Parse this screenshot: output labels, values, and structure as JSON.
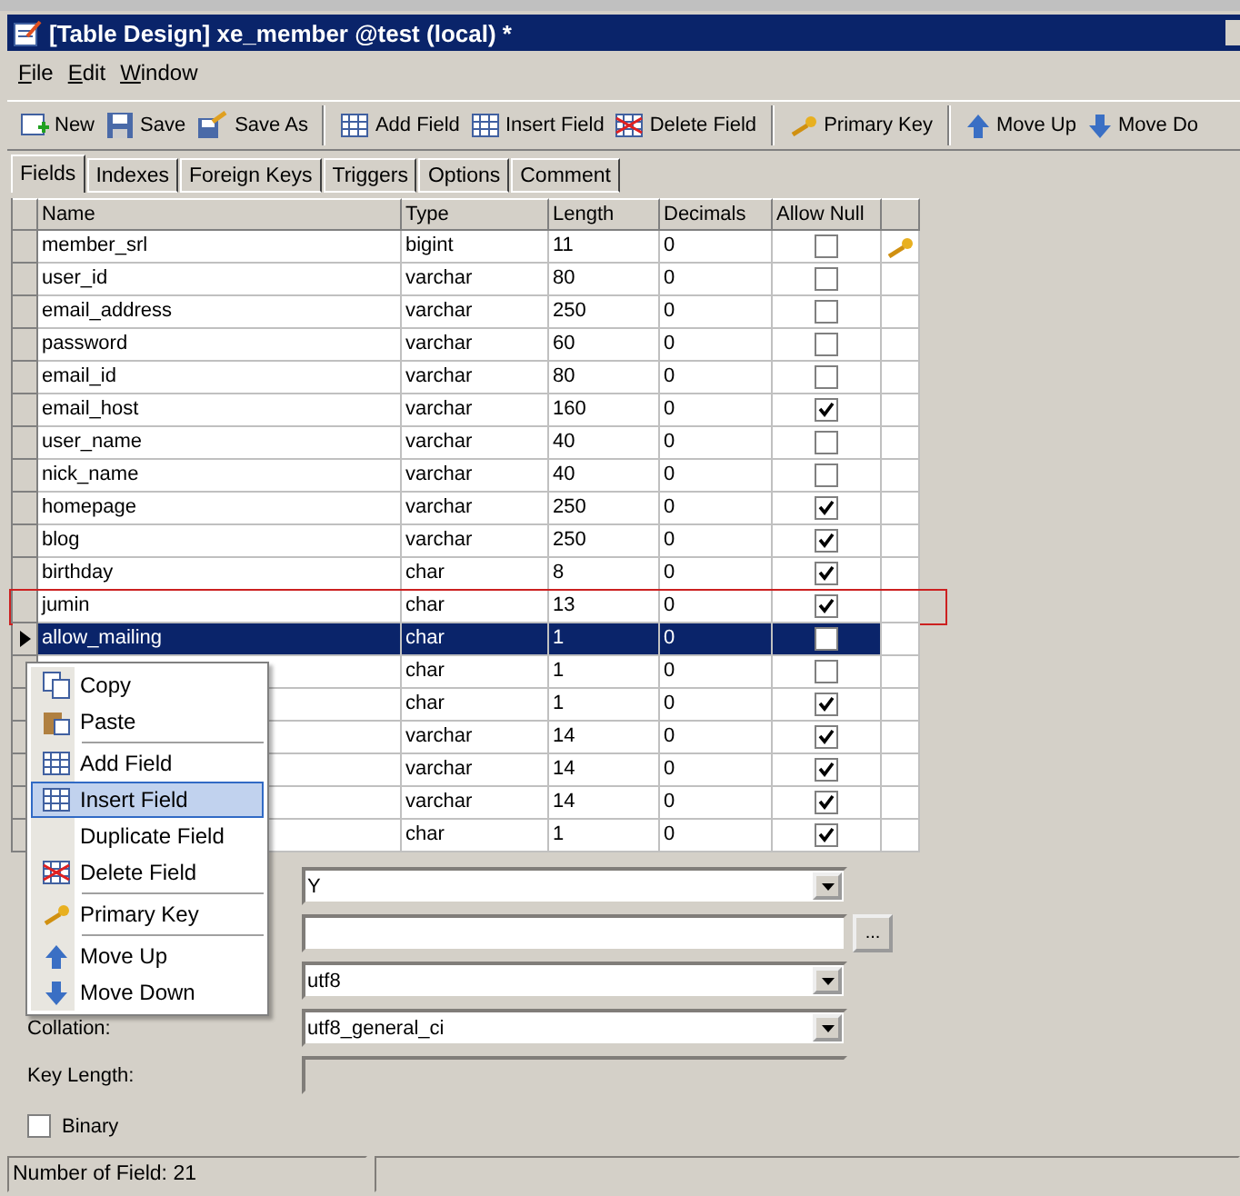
{
  "window": {
    "title": "[Table Design] xe_member @test (local) *"
  },
  "menu_bar": [
    "File",
    "Edit",
    "Window"
  ],
  "toolbar": [
    [
      "New",
      "Save",
      "Save As"
    ],
    [
      "Add Field",
      "Insert Field",
      "Delete Field"
    ],
    [
      "Primary Key"
    ],
    [
      "Move Up",
      "Move Do"
    ]
  ],
  "tabs": [
    {
      "label": "Fields",
      "selected": true
    },
    {
      "label": "Indexes",
      "selected": false
    },
    {
      "label": "Foreign Keys",
      "selected": false
    },
    {
      "label": "Triggers",
      "selected": false
    },
    {
      "label": "Options",
      "selected": false
    },
    {
      "label": "Comment",
      "selected": false
    }
  ],
  "table": {
    "columns": [
      "Name",
      "Type",
      "Length",
      "Decimals",
      "Allow Null"
    ],
    "rows": [
      {
        "name": "member_srl",
        "type": "bigint",
        "length": "11",
        "decimals": "0",
        "allow_null": false,
        "primary_key": true,
        "selected": false,
        "highlighted": false
      },
      {
        "name": "user_id",
        "type": "varchar",
        "length": "80",
        "decimals": "0",
        "allow_null": false,
        "primary_key": false,
        "selected": false,
        "highlighted": false
      },
      {
        "name": "email_address",
        "type": "varchar",
        "length": "250",
        "decimals": "0",
        "allow_null": false,
        "primary_key": false,
        "selected": false,
        "highlighted": false
      },
      {
        "name": "password",
        "type": "varchar",
        "length": "60",
        "decimals": "0",
        "allow_null": false,
        "primary_key": false,
        "selected": false,
        "highlighted": false
      },
      {
        "name": "email_id",
        "type": "varchar",
        "length": "80",
        "decimals": "0",
        "allow_null": false,
        "primary_key": false,
        "selected": false,
        "highlighted": false
      },
      {
        "name": "email_host",
        "type": "varchar",
        "length": "160",
        "decimals": "0",
        "allow_null": true,
        "primary_key": false,
        "selected": false,
        "highlighted": false
      },
      {
        "name": "user_name",
        "type": "varchar",
        "length": "40",
        "decimals": "0",
        "allow_null": false,
        "primary_key": false,
        "selected": false,
        "highlighted": false
      },
      {
        "name": "nick_name",
        "type": "varchar",
        "length": "40",
        "decimals": "0",
        "allow_null": false,
        "primary_key": false,
        "selected": false,
        "highlighted": false
      },
      {
        "name": "homepage",
        "type": "varchar",
        "length": "250",
        "decimals": "0",
        "allow_null": true,
        "primary_key": false,
        "selected": false,
        "highlighted": false
      },
      {
        "name": "blog",
        "type": "varchar",
        "length": "250",
        "decimals": "0",
        "allow_null": true,
        "primary_key": false,
        "selected": false,
        "highlighted": false
      },
      {
        "name": "birthday",
        "type": "char",
        "length": "8",
        "decimals": "0",
        "allow_null": true,
        "primary_key": false,
        "selected": false,
        "highlighted": false
      },
      {
        "name": "jumin",
        "type": "char",
        "length": "13",
        "decimals": "0",
        "allow_null": true,
        "primary_key": false,
        "selected": false,
        "highlighted": true
      },
      {
        "name": "allow_mailing",
        "type": "char",
        "length": "1",
        "decimals": "0",
        "allow_null": false,
        "primary_key": false,
        "selected": true,
        "highlighted": false
      },
      {
        "type": "char",
        "length": "1",
        "decimals": "0",
        "allow_null": false,
        "primary_key": false,
        "selected": false,
        "highlighted": false
      },
      {
        "type": "char",
        "length": "1",
        "decimals": "0",
        "allow_null": true,
        "primary_key": false,
        "selected": false,
        "highlighted": false
      },
      {
        "type": "varchar",
        "length": "14",
        "decimals": "0",
        "allow_null": true,
        "primary_key": false,
        "selected": false,
        "highlighted": false
      },
      {
        "type": "varchar",
        "length": "14",
        "decimals": "0",
        "allow_null": true,
        "primary_key": false,
        "selected": false,
        "highlighted": false
      },
      {
        "type": "varchar",
        "length": "14",
        "decimals": "0",
        "allow_null": true,
        "primary_key": false,
        "selected": false,
        "highlighted": false
      },
      {
        "type": "char",
        "length": "1",
        "decimals": "0",
        "allow_null": true,
        "primary_key": false,
        "selected": false,
        "highlighted": false
      }
    ]
  },
  "properties": [
    {
      "kind": "combo",
      "value": "Y"
    },
    {
      "kind": "browse",
      "button": "..."
    },
    {
      "kind": "combo",
      "value": "utf8"
    },
    {
      "kind": "combo",
      "label": "Collation:",
      "value": "utf8_general_ci"
    },
    {
      "kind": "readonly",
      "label": "Key Length:"
    },
    {
      "kind": "checkbox",
      "label": "Binary",
      "checked": false
    }
  ],
  "context_menu": [
    [
      {
        "label": "Copy",
        "selected": false
      },
      {
        "label": "Paste",
        "selected": false
      }
    ],
    [
      {
        "label": "Add Field",
        "selected": false
      },
      {
        "label": "Insert Field",
        "selected": true
      },
      {
        "label": "Duplicate Field",
        "selected": false
      },
      {
        "label": "Delete Field",
        "selected": false
      }
    ],
    [
      {
        "label": "Primary Key",
        "selected": false
      }
    ],
    [
      {
        "label": "Move Up",
        "selected": false
      },
      {
        "label": "Move Down",
        "selected": false
      }
    ]
  ],
  "status_bar": [
    "Number of Field: 21"
  ]
}
